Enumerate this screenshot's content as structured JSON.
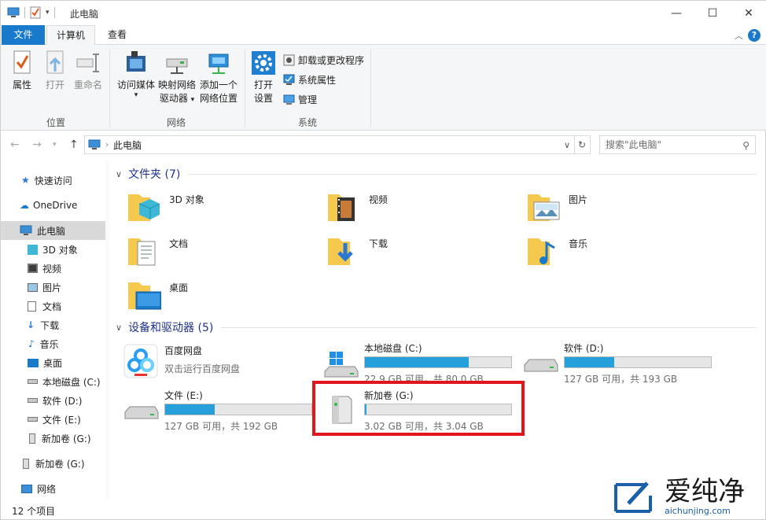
{
  "window": {
    "title": "此电脑",
    "controls": {
      "minimize": "—",
      "maximize": "☐",
      "close": "✕"
    }
  },
  "tabs": {
    "file": "文件",
    "computer": "计算机",
    "view": "查看"
  },
  "ribbon": {
    "location": {
      "properties": "属性",
      "open": "打开",
      "rename": "重命名",
      "group": "位置"
    },
    "network": {
      "access_media": "访问媒体",
      "map_drive_line1": "映射网络",
      "map_drive_line2": "驱动器",
      "add_location_line1": "添加一个",
      "add_location_line2": "网络位置",
      "group": "网络"
    },
    "system": {
      "open_settings_line1": "打开",
      "open_settings_line2": "设置",
      "uninstall": "卸载或更改程序",
      "sys_props": "系统属性",
      "manage": "管理",
      "group": "系统"
    }
  },
  "address": {
    "path": "此电脑",
    "search_placeholder": "搜索\"此电脑\""
  },
  "sidebar": {
    "items": [
      {
        "label": "快速访问",
        "icon": "star-icon"
      },
      {
        "label": "OneDrive",
        "icon": "cloud-icon"
      },
      {
        "label": "此电脑",
        "icon": "computer-icon"
      },
      {
        "label": "3D 对象",
        "icon": "cube-icon"
      },
      {
        "label": "视频",
        "icon": "video-icon"
      },
      {
        "label": "图片",
        "icon": "picture-icon"
      },
      {
        "label": "文档",
        "icon": "document-icon"
      },
      {
        "label": "下载",
        "icon": "download-icon"
      },
      {
        "label": "音乐",
        "icon": "music-icon"
      },
      {
        "label": "桌面",
        "icon": "desktop-icon"
      },
      {
        "label": "本地磁盘 (C:)",
        "icon": "drive-icon"
      },
      {
        "label": "软件 (D:)",
        "icon": "drive-icon"
      },
      {
        "label": "文件 (E:)",
        "icon": "drive-icon"
      },
      {
        "label": "新加卷 (G:)",
        "icon": "usb-drive-icon"
      },
      {
        "label": "新加卷 (G:)",
        "icon": "usb-drive-icon"
      },
      {
        "label": "网络",
        "icon": "network-icon"
      }
    ]
  },
  "folders": {
    "header": "文件夹 (7)",
    "items": [
      "3D 对象",
      "视频",
      "图片",
      "文档",
      "下载",
      "音乐",
      "桌面"
    ]
  },
  "devices": {
    "header": "设备和驱动器 (5)",
    "items": [
      {
        "name": "百度网盘",
        "sub": "双击运行百度网盘"
      },
      {
        "name": "本地磁盘 (C:)",
        "size": "22.9 GB 可用，共 80.0 GB",
        "used": 0.71
      },
      {
        "name": "软件 (D:)",
        "size": "127 GB 可用，共 193 GB",
        "used": 0.34
      },
      {
        "name": "文件 (E:)",
        "size": "127 GB 可用，共 192 GB",
        "used": 0.34
      },
      {
        "name": "新加卷 (G:)",
        "size": "3.02 GB 可用，共 3.04 GB",
        "used": 0.01
      }
    ]
  },
  "status": {
    "count": "12 个项目"
  },
  "watermark": {
    "text": "爱纯净",
    "url": "aichunjing.com"
  },
  "colors": {
    "accent": "#1979ca",
    "bar_fill": "#26a0da",
    "highlight": "#e0161c"
  }
}
